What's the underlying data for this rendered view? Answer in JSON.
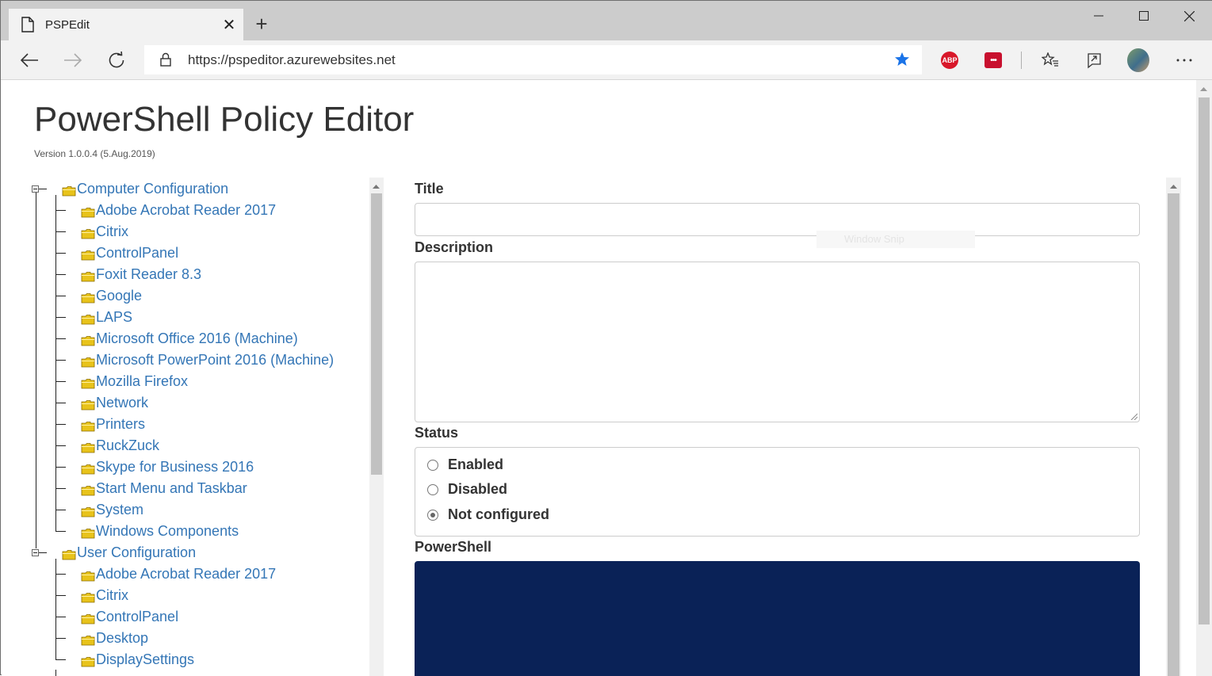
{
  "browser": {
    "tab_title": "PSPEdit",
    "url": "https://pspeditor.azurewebsites.net",
    "extensions": {
      "adblock_label": "ABP",
      "lastpass_label": "•••"
    }
  },
  "page": {
    "title": "PowerShell Policy Editor",
    "version": "Version 1.0.0.4 (5.Aug.2019)"
  },
  "tree": {
    "computer_configuration": {
      "label": "Computer Configuration",
      "items": [
        "Adobe Acrobat Reader 2017",
        "Citrix",
        "ControlPanel",
        "Foxit Reader 8.3",
        "Google",
        "LAPS",
        "Microsoft Office 2016 (Machine)",
        "Microsoft PowerPoint 2016 (Machine)",
        "Mozilla Firefox",
        "Network",
        "Printers",
        "RuckZuck",
        "Skype for Business 2016",
        "Start Menu and Taskbar",
        "System",
        "Windows Components"
      ]
    },
    "user_configuration": {
      "label": "User Configuration",
      "items": [
        "Adobe Acrobat Reader 2017",
        "Citrix",
        "ControlPanel",
        "Desktop",
        "DisplaySettings"
      ]
    }
  },
  "form": {
    "title_label": "Title",
    "title_value": "",
    "description_label": "Description",
    "description_value": "",
    "ghost_text": "Window Snip",
    "status_label": "Status",
    "status_options": [
      {
        "label": "Enabled",
        "checked": false
      },
      {
        "label": "Disabled",
        "checked": false
      },
      {
        "label": "Not configured",
        "checked": true
      }
    ],
    "powershell_label": "PowerShell",
    "powershell_bg": "#0a2257"
  },
  "colors": {
    "link": "#3476b6",
    "star": "#1a73e8"
  }
}
